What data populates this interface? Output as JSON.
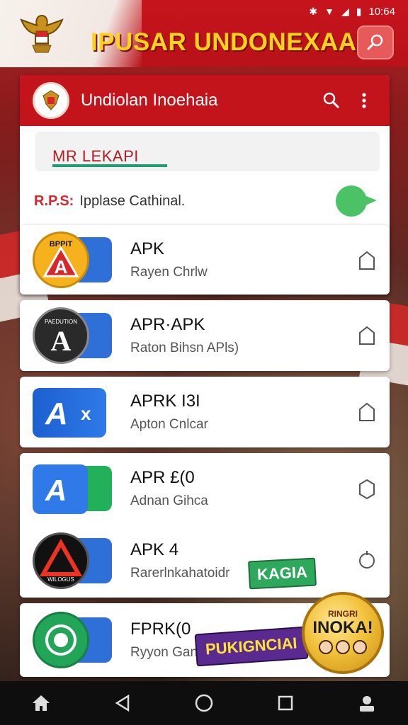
{
  "status_bar": {
    "time": "10:64"
  },
  "banner": {
    "title": "IPUSAR UNDONEXAA"
  },
  "app_header": {
    "title": "Undiolan Inoehaia"
  },
  "search": {
    "value": "MR LEKAPI"
  },
  "hint": {
    "prefix": "R.P.S:",
    "text": "Ipplase Cathinal."
  },
  "list": [
    {
      "title": "APK",
      "subtitle": "Rayen Chrlw"
    },
    {
      "title": "APR·APK",
      "subtitle": "Raton Bihsn APls)"
    },
    {
      "title": "APRK I3I",
      "subtitle": "Apton Cnlcar"
    },
    {
      "title": "APR £(0",
      "subtitle": "Adnan Gihca"
    },
    {
      "title": "APK 4",
      "subtitle": "Rarerlnkahatoidr"
    },
    {
      "title": "FPRK(0",
      "subtitle": "Ryyon Gank"
    }
  ],
  "badges": {
    "green": "KAGIA",
    "purple": "PUKIGNCIAI"
  },
  "coin": {
    "top": "RINGRI",
    "main": "INOKA!"
  },
  "icon_labels": {
    "first": "BPPIT",
    "second": "PAEDUTION",
    "fifth": "WILOGUS"
  }
}
